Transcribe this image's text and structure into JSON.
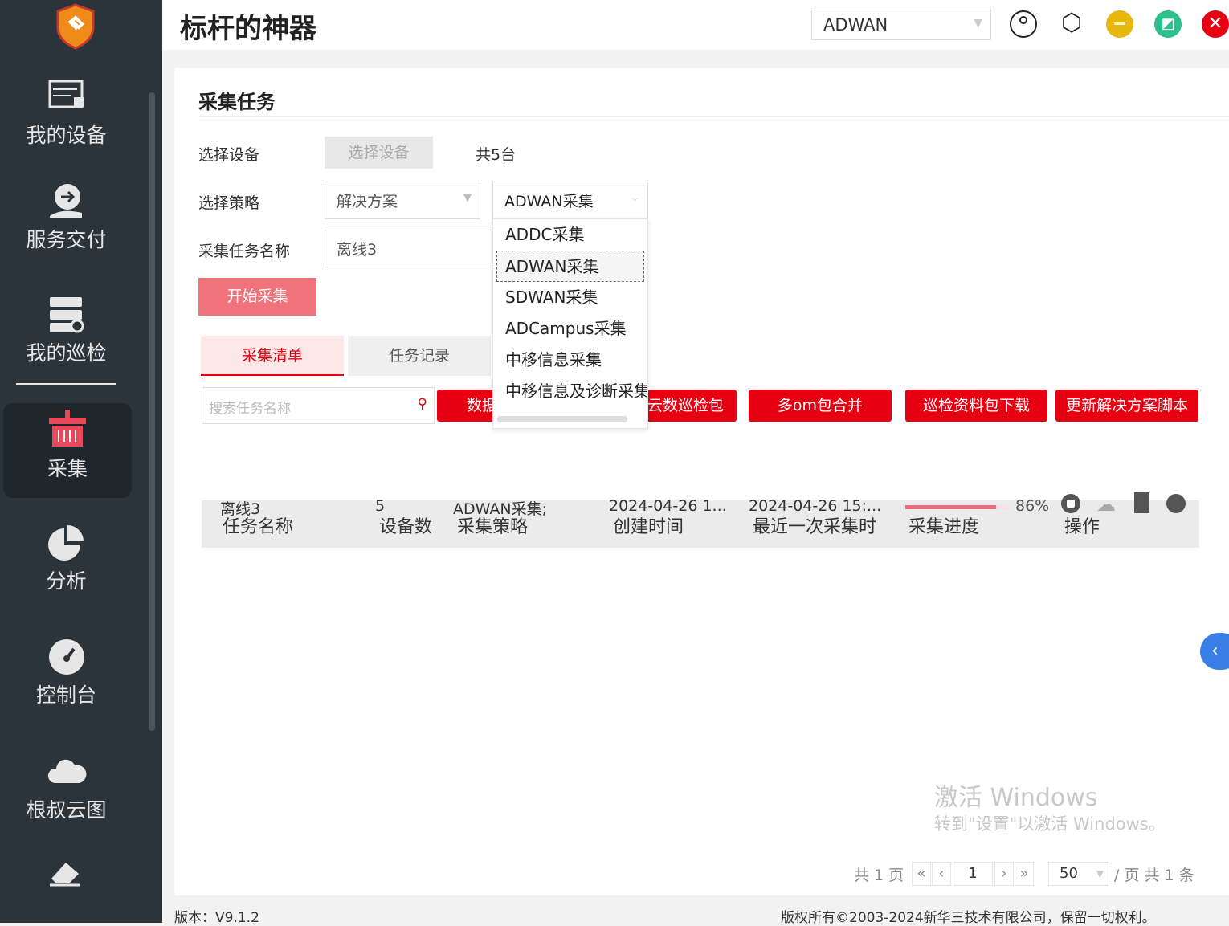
{
  "app": {
    "title": "标杆的神器",
    "product_select": "ADWAN"
  },
  "window_controls": {
    "user": "user-icon",
    "settings": "settings-icon",
    "minimize": "minimize",
    "restore": "restore",
    "close": "close"
  },
  "sidebar": {
    "items": [
      {
        "label": "我的设备",
        "icon": "device-icon"
      },
      {
        "label": "服务交付",
        "icon": "delivery-icon"
      },
      {
        "label": "我的巡检",
        "icon": "inspection-icon"
      },
      {
        "label": "采集",
        "icon": "collect-icon",
        "active": true
      },
      {
        "label": "分析",
        "icon": "pie-chart-icon"
      },
      {
        "label": "控制台",
        "icon": "dashboard-icon"
      },
      {
        "label": "根叔云图",
        "icon": "cloud-icon"
      }
    ]
  },
  "page": {
    "title": "采集任务",
    "select_device_label": "选择设备",
    "select_device_button": "选择设备",
    "device_count": "共5台",
    "select_policy_label": "选择策略",
    "policy_type": "解决方案",
    "policy_value": "ADWAN采集",
    "task_name_label": "采集任务名称",
    "task_name_value": "离线3",
    "start_button": "开始采集",
    "dropdown_options": [
      "ADDC采集",
      "ADWAN采集",
      "SDWAN采集",
      "ADCampus采集",
      "中移信息采集",
      "中移信息及诊断采集"
    ],
    "tabs": [
      {
        "label": "采集清单",
        "active": true
      },
      {
        "label": "任务记录"
      }
    ],
    "search_placeholder": "搜索任务名称",
    "actions": [
      "数据",
      "云数巡检包",
      "多om包合并",
      "巡检资料包下载",
      "更新解决方案脚本"
    ],
    "table": {
      "headers": [
        "任务名称",
        "设备数",
        "采集策略",
        "创建时间",
        "最近一次采集时",
        "采集进度",
        "操作"
      ],
      "rows": [
        {
          "name": "离线3",
          "devices": "5",
          "policy": "ADWAN采集;",
          "created": "2024-04-26 1...",
          "last": "2024-04-26 15:...",
          "progress": 86,
          "progress_label": "86%"
        }
      ]
    },
    "pagination": {
      "total_pages": "共 1 页",
      "page": "1",
      "page_size": "50",
      "summary": "/ 页 共 1 条"
    }
  },
  "watermark": {
    "line1": "激活 Windows",
    "line2": "转到\"设置\"以激活 Windows。"
  },
  "footer": {
    "version": "版本：V9.1.2",
    "copyright": "版权所有©2003-2024新华三技术有限公司，保留一切权利。"
  },
  "colors": {
    "sidebar": "#2c343b",
    "accent": "#e60012",
    "progress": "#f06a7b"
  }
}
